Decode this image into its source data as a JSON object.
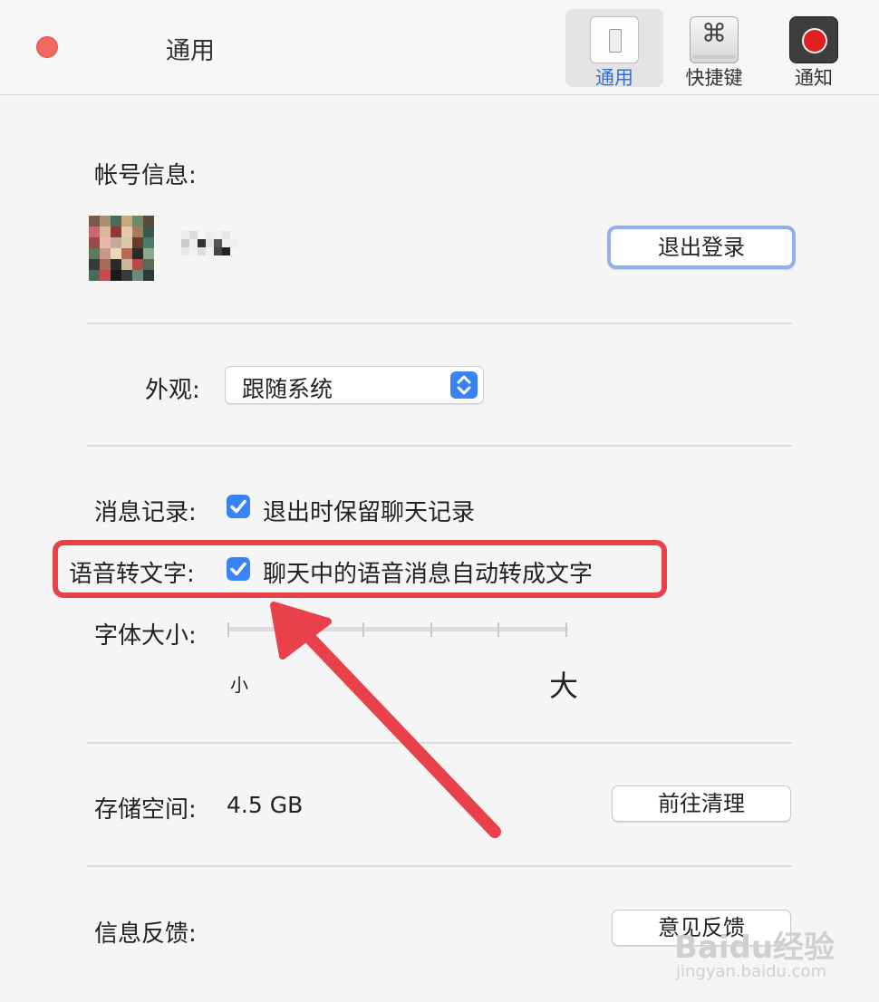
{
  "window": {
    "title": "通用"
  },
  "toolbar": {
    "items": [
      {
        "label": "通用",
        "active": true
      },
      {
        "label": "快捷键",
        "icon_glyph": "⌘"
      },
      {
        "label": "通知"
      }
    ]
  },
  "account": {
    "label": "帐号信息:",
    "logout_label": "退出登录"
  },
  "appearance": {
    "label": "外观:",
    "selected": "跟随系统"
  },
  "history": {
    "label": "消息记录:",
    "checkbox_label": "退出时保留聊天记录",
    "checked": true
  },
  "voice": {
    "label": "语音转文字:",
    "checkbox_label": "聊天中的语音消息自动转成文字",
    "checked": true
  },
  "font_size": {
    "label": "字体大小:",
    "min_label": "小",
    "max_label": "大",
    "ticks": 6
  },
  "storage": {
    "label": "存储空间:",
    "value": "4.5 GB",
    "button_label": "前往清理"
  },
  "feedback": {
    "label": "信息反馈:",
    "button_label": "意见反馈"
  },
  "annotation": {
    "color": "#e8414a"
  },
  "colors": {
    "accent": "#3a82f7",
    "close": "#ee6a5f"
  },
  "watermark": {
    "brand": "Baidu",
    "brand_cn": "经验",
    "url": "jingyan.baidu.com"
  }
}
